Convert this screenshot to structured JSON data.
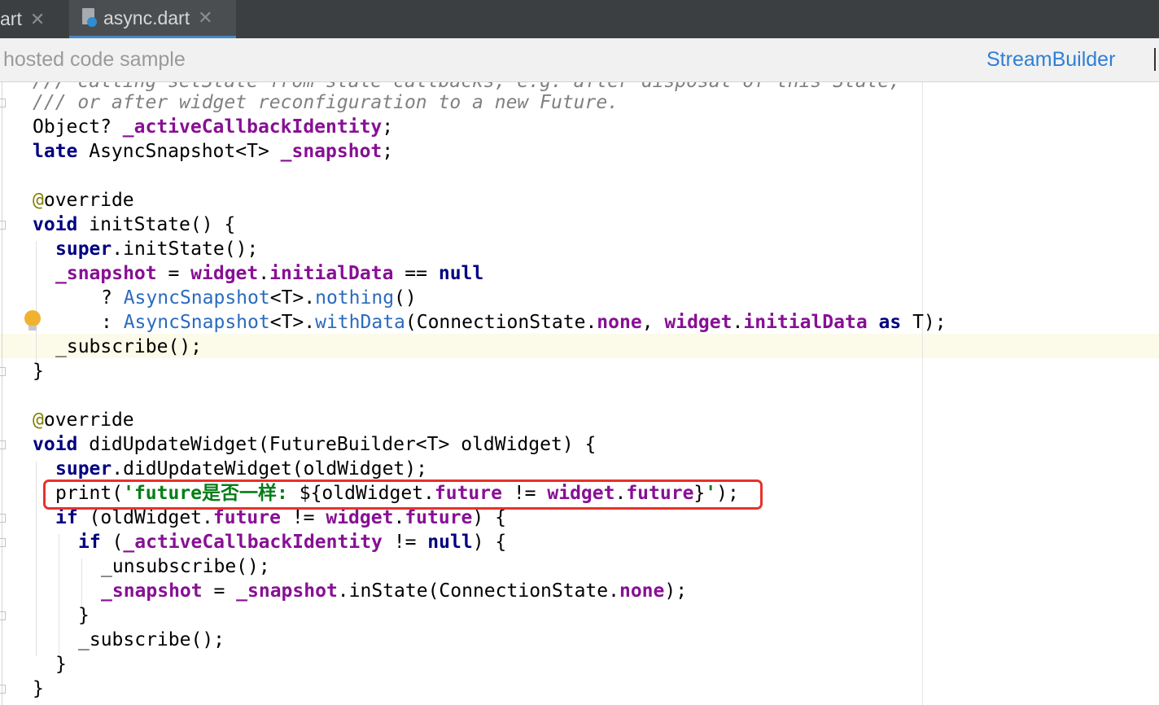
{
  "tabs": [
    {
      "label": "art",
      "close_icon": "close-icon",
      "active": false
    },
    {
      "label": "async.dart",
      "close_icon": "close-icon",
      "icon": "dart-file-icon",
      "active": true
    }
  ],
  "sample_bar": {
    "label": "hosted code sample",
    "link": "StreamBuilder"
  },
  "code": {
    "l0": "/// calling setState from stale callbacks, e.g. after disposal of this State,",
    "l1": "/// or after widget reconfiguration to a new Future.",
    "l2_a": "Object? ",
    "l2_b": "_activeCallbackIdentity",
    "l2_c": ";",
    "l3_a": "late",
    "l3_b": " AsyncSnapshot<T> ",
    "l3_c": "_snapshot",
    "l3_d": ";",
    "l5_a": "@",
    "l5_b": "override",
    "l6_a": "void",
    "l6_b": " initState() {",
    "l7_a": "super",
    "l7_b": ".initState();",
    "l8_a": "_snapshot",
    "l8_b": " = ",
    "l8_c": "widget",
    "l8_d": ".",
    "l8_e": "initialData",
    "l8_f": " == ",
    "l8_g": "null",
    "l9_a": "? ",
    "l9_b": "AsyncSnapshot",
    "l9_c": "<T>.",
    "l9_d": "nothing",
    "l9_e": "()",
    "l10_a": ": ",
    "l10_b": "AsyncSnapshot",
    "l10_c": "<T>.",
    "l10_d": "withData",
    "l10_e": "(ConnectionState.",
    "l10_f": "none",
    "l10_g": ", ",
    "l10_h": "widget",
    "l10_i": ".",
    "l10_j": "initialData",
    "l10_k": " ",
    "l10_l": "as",
    "l10_m": " T);",
    "l11": "_subscribe();",
    "l12": "}",
    "l14_a": "@",
    "l14_b": "override",
    "l15_a": "void",
    "l15_b": " didUpdateWidget(FutureBuilder<T> oldWidget) {",
    "l16_a": "super",
    "l16_b": ".didUpdateWidget(oldWidget);",
    "l17_a": "print(",
    "l17_b": "'future是否一样: ",
    "l17_c": "${oldWidget.",
    "l17_d": "future",
    "l17_e": " != ",
    "l17_f": "widget",
    "l17_g": ".",
    "l17_h": "future",
    "l17_i": "}",
    "l17_j": "'",
    "l17_k": ");",
    "l18_a": "if",
    "l18_b": " (oldWidget.",
    "l18_c": "future",
    "l18_d": " != ",
    "l18_e": "widget",
    "l18_f": ".",
    "l18_g": "future",
    "l18_h": ") {",
    "l19_a": "if",
    "l19_b": " (",
    "l19_c": "_activeCallbackIdentity",
    "l19_d": " != ",
    "l19_e": "null",
    "l19_f": ") {",
    "l20": "_unsubscribe();",
    "l21_a": "_snapshot",
    "l21_b": " = ",
    "l21_c": "_snapshot",
    "l21_d": ".inState(ConnectionState.",
    "l21_e": "none",
    "l21_f": ");",
    "l22": "}",
    "l23": "_subscribe();",
    "l24": "}",
    "l25": "}"
  },
  "colors": {
    "highlight_box": "#e8322a",
    "keyword": "#000080",
    "field": "#871094",
    "string": "#067d17",
    "link": "#2f7fd6"
  }
}
